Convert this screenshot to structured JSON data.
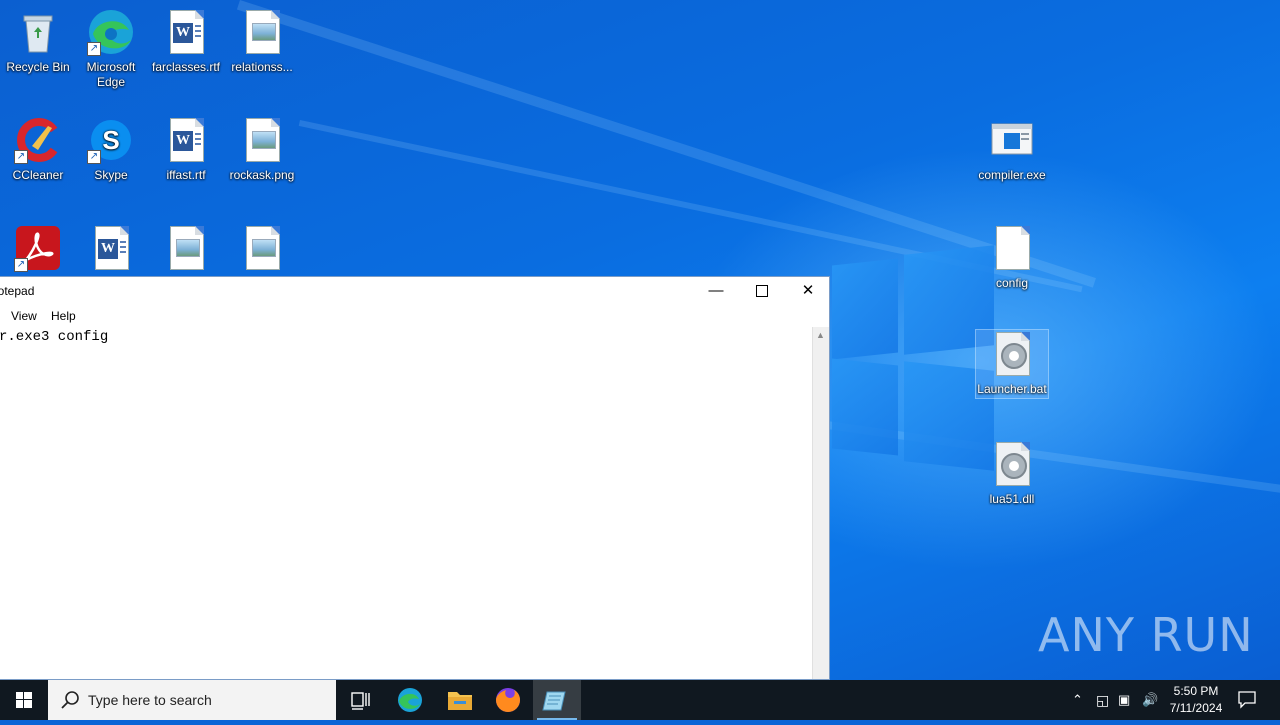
{
  "desktop": {
    "icons": [
      {
        "label": "Recycle Bin"
      },
      {
        "label": "Microsoft Edge"
      },
      {
        "label": "farclasses.rtf"
      },
      {
        "label": "relationss..."
      },
      {
        "label": "CCleaner"
      },
      {
        "label": "Skype"
      },
      {
        "label": "iffast.rtf"
      },
      {
        "label": "rockask.png"
      },
      {
        "label": "compiler.exe"
      },
      {
        "label": "config"
      },
      {
        "label": "Launcher.bat"
      },
      {
        "label": "lua51.dll"
      }
    ],
    "watermark": "ANY RUN"
  },
  "notepad": {
    "title": "Notepad",
    "menu": [
      "View",
      "Help"
    ],
    "content": "r.exe3 config"
  },
  "taskbar": {
    "search_placeholder": "Type here to search",
    "time": "5:50 PM",
    "date": "7/11/2024"
  },
  "colors": {
    "accent": "#0a64d6",
    "taskbar": "#101820",
    "active_indicator": "#76b9ed"
  }
}
